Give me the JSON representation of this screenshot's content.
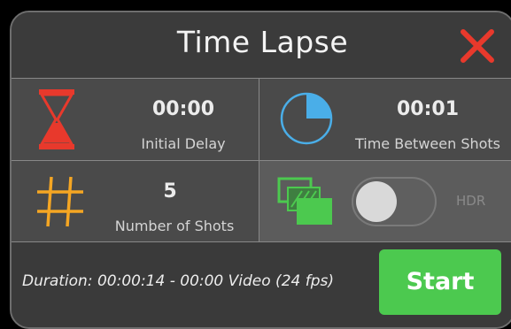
{
  "header": {
    "title": "Time Lapse",
    "close_icon": "close-x-icon",
    "close_color": "#e8392c"
  },
  "settings": {
    "initial_delay": {
      "value": "00:00",
      "label": "Initial Delay",
      "icon": "hourglass-icon",
      "icon_color": "#e8392c"
    },
    "time_between_shots": {
      "value": "00:01",
      "label": "Time Between Shots",
      "icon": "pie-timer-icon",
      "icon_color": "#4aaee8"
    },
    "number_of_shots": {
      "value": "5",
      "label": "Number of Shots",
      "icon": "hash-icon",
      "icon_color": "#f5a623"
    },
    "hdr": {
      "label": "HDR",
      "icon": "layered-frames-icon",
      "icon_color": "#4cc94f",
      "enabled": false
    }
  },
  "footer": {
    "duration_text": "Duration: 00:00:14 - 00:00 Video (24 fps)",
    "start_label": "Start",
    "start_color": "#4cc94f"
  }
}
